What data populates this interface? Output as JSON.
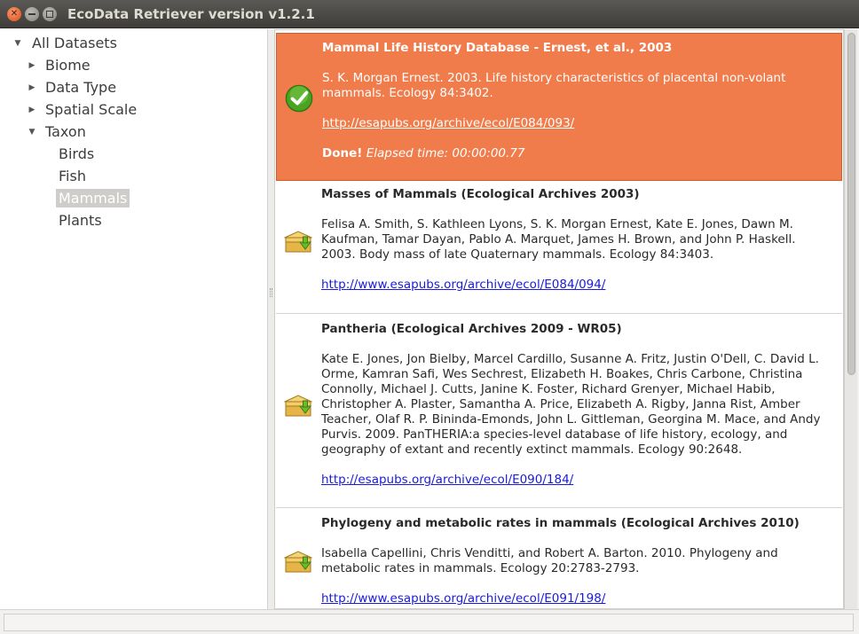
{
  "window": {
    "title": "EcoData Retriever version v1.2.1"
  },
  "sidebar": {
    "root": "All Datasets",
    "categories": [
      "Biome",
      "Data Type",
      "Spatial Scale",
      "Taxon"
    ],
    "taxon_children": [
      "Birds",
      "Fish",
      "Mammals",
      "Plants"
    ],
    "selected": "Mammals"
  },
  "datasets": [
    {
      "title": "Mammal Life History Database - Ernest, et al., 2003",
      "citation": "S. K. Morgan Ernest. 2003. Life history characteristics of placental non-volant mammals. Ecology 84:3402.",
      "link": "http://esapubs.org/archive/ecol/E084/093/",
      "status_label": "Done!",
      "status_detail": "Elapsed time: 00:00:00.77",
      "state": "done"
    },
    {
      "title": "Masses of Mammals (Ecological Archives 2003)",
      "citation": "Felisa A. Smith, S. Kathleen Lyons, S. K. Morgan Ernest, Kate E. Jones, Dawn M. Kaufman, Tamar Dayan, Pablo A. Marquet, James H. Brown, and John P. Haskell. 2003. Body mass of late Quaternary mammals. Ecology 84:3403.",
      "link": "http://www.esapubs.org/archive/ecol/E084/094/",
      "state": "download"
    },
    {
      "title": "Pantheria (Ecological Archives 2009 - WR05)",
      "citation": "Kate E. Jones, Jon Bielby, Marcel Cardillo, Susanne A. Fritz, Justin O'Dell, C. David L. Orme, Kamran Safi, Wes Sechrest, Elizabeth H. Boakes, Chris Carbone, Christina Connolly, Michael J. Cutts, Janine K. Foster, Richard Grenyer, Michael Habib, Christopher A. Plaster, Samantha A. Price, Elizabeth A. Rigby, Janna Rist, Amber Teacher, Olaf R. P. Bininda-Emonds, John L. Gittleman, Georgina M. Mace, and Andy Purvis. 2009. PanTHERIA:a species-level database of life history, ecology, and geography of extant and recently extinct mammals. Ecology 90:2648.",
      "link": "http://esapubs.org/archive/ecol/E090/184/",
      "state": "download"
    },
    {
      "title": "Phylogeny and metabolic rates in mammals (Ecological Archives 2010)",
      "citation": "Isabella Capellini, Chris Venditti, and Robert A. Barton. 2010. Phylogeny and metabolic rates in mammals. Ecology 20:2783-2793.",
      "link": "http://www.esapubs.org/archive/ecol/E091/198/",
      "state": "download"
    }
  ],
  "colors": {
    "active_bg": "#f07c4c",
    "link": "#1a1adb",
    "done_check": "#3f9a1e"
  },
  "icons": {
    "done": "checkmark-icon",
    "download": "download-box-icon"
  }
}
